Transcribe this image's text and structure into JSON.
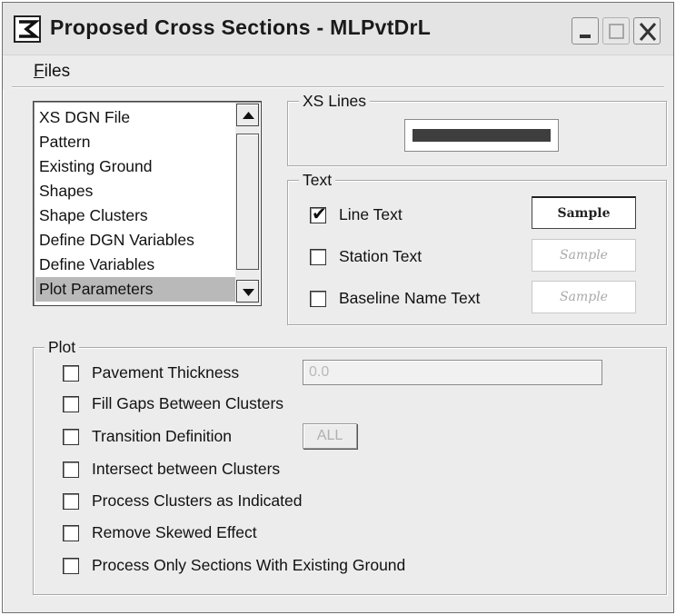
{
  "window": {
    "title": "Proposed Cross Sections - MLPvtDrL"
  },
  "menu": {
    "files_first": "F",
    "files_rest": "iles"
  },
  "list": {
    "items": [
      "XS DGN File",
      "Pattern",
      "Existing Ground",
      "Shapes",
      "Shape Clusters",
      "Define DGN Variables",
      "Define Variables",
      "Plot Parameters"
    ],
    "selected": "Plot Parameters"
  },
  "xs_lines": {
    "title": "XS Lines"
  },
  "text_group": {
    "title": "Text",
    "line_text": {
      "label": "Line Text",
      "checked": true,
      "sample": "Sample"
    },
    "station_text": {
      "label": "Station Text",
      "checked": false,
      "sample": "Sample"
    },
    "baseline_text": {
      "label": "Baseline Name Text",
      "checked": false,
      "sample": "Sample"
    }
  },
  "plot": {
    "title": "Plot",
    "pavement_thickness": {
      "label": "Pavement Thickness",
      "value": "0.0",
      "checked": false
    },
    "fill_gaps": {
      "label": "Fill Gaps Between Clusters",
      "checked": false
    },
    "transition": {
      "label": "Transition Definition",
      "button": "ALL",
      "checked": false
    },
    "intersect": {
      "label": "Intersect between Clusters",
      "checked": false
    },
    "process_indicated": {
      "label": "Process Clusters as Indicated",
      "checked": false
    },
    "remove_skewed": {
      "label": "Remove Skewed Effect",
      "checked": false
    },
    "only_existing": {
      "label": "Process Only Sections With Existing Ground",
      "checked": false
    }
  },
  "colors": {
    "window_bg": "#ececec",
    "selected_item": "#b9b9b9",
    "xs_line": "#3e3e3e"
  }
}
